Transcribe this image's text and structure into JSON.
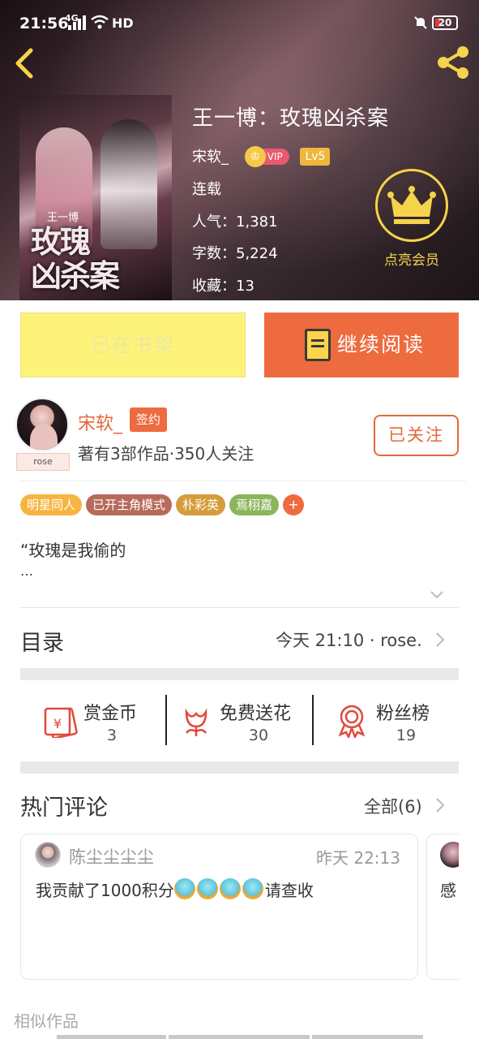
{
  "status_bar": {
    "time": "21:56",
    "network": "4G",
    "hd": "HD",
    "battery": "20"
  },
  "book": {
    "title": "王一博：玫瑰凶杀案",
    "author": "宋软_",
    "vip_label": "VIP",
    "level": "Lv5",
    "status": "连载",
    "popularity_label": "人气：",
    "popularity": "1,381",
    "word_count_label": "字数：",
    "word_count": "5,224",
    "favorites_label": "收藏：",
    "favorites": "13",
    "cover_text": "玫瑰\n凶杀案",
    "cover_small_text": "王一博"
  },
  "member": {
    "label": "点亮会员"
  },
  "actions": {
    "shelf_label": "已在书架",
    "read_label": "继续阅读"
  },
  "author": {
    "name": "宋软_",
    "signed_badge": "签约",
    "avatar_tag": "rose",
    "meta": "著有3部作品·350人关注",
    "follow_label": "已关注"
  },
  "tags": [
    "明星同人",
    "已开主角模式",
    "朴彩英",
    "焉栩嘉"
  ],
  "tag_more": "+",
  "synopsis": {
    "text": "“玫瑰是我偷的",
    "ellipsis": "…"
  },
  "toc": {
    "title": "目录",
    "latest": "今天 21:10 · rose."
  },
  "stats": [
    {
      "label": "赏金币",
      "count": "3",
      "icon": "reward-coin-icon"
    },
    {
      "label": "免费送花",
      "count": "30",
      "icon": "flower-icon"
    },
    {
      "label": "粉丝榜",
      "count": "19",
      "icon": "ribbon-medal-icon"
    }
  ],
  "comments": {
    "title": "热门评论",
    "all_label": "全部(6)",
    "items": [
      {
        "user": "陈尘尘尘尘",
        "time": "昨天 22:13",
        "text_before": "我贡献了1000积分",
        "emoji_count": 4,
        "text_after": "请查收"
      },
      {
        "text": "感"
      }
    ]
  },
  "similar": {
    "title": "相似作品"
  },
  "colors": {
    "accent": "#ee6b3f",
    "shelf": "#fdf37a",
    "member_gold": "#f5d34a"
  }
}
